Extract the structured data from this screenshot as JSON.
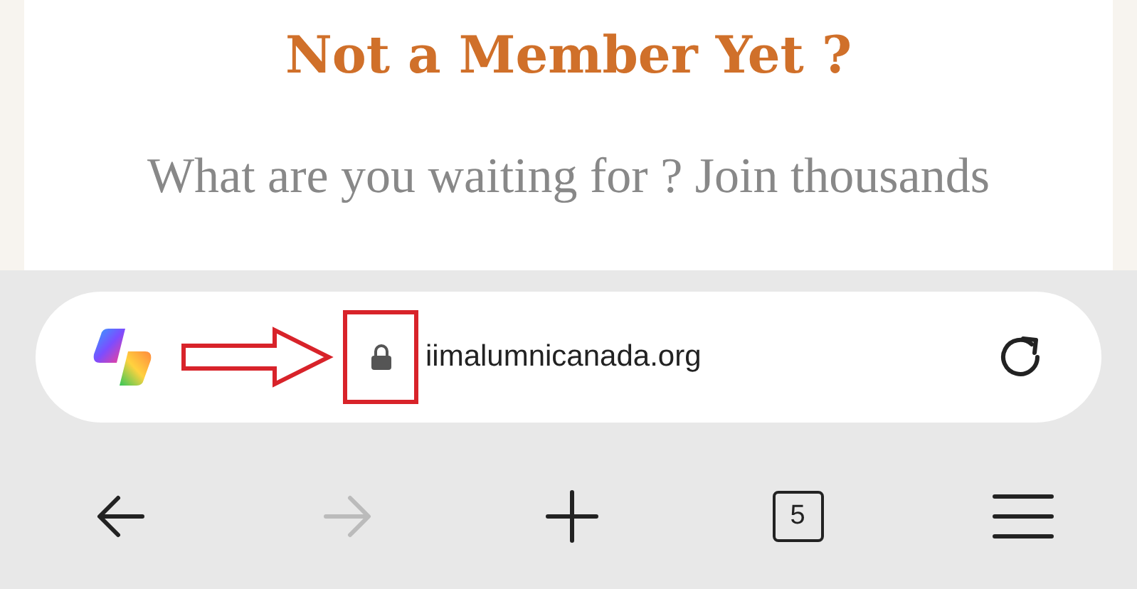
{
  "page": {
    "heading": "Not a Member Yet ?",
    "text": "What are you waiting for ? Join thousands"
  },
  "address_bar": {
    "url": "iimalumnicanada.org",
    "secure": true
  },
  "toolbar": [
    {
      "kind": "back",
      "disabled": false
    },
    {
      "kind": "forward",
      "disabled": true
    },
    {
      "kind": "new-tab",
      "disabled": false
    },
    {
      "kind": "tabs",
      "count": "5",
      "disabled": false
    },
    {
      "kind": "menu",
      "disabled": false
    }
  ]
}
